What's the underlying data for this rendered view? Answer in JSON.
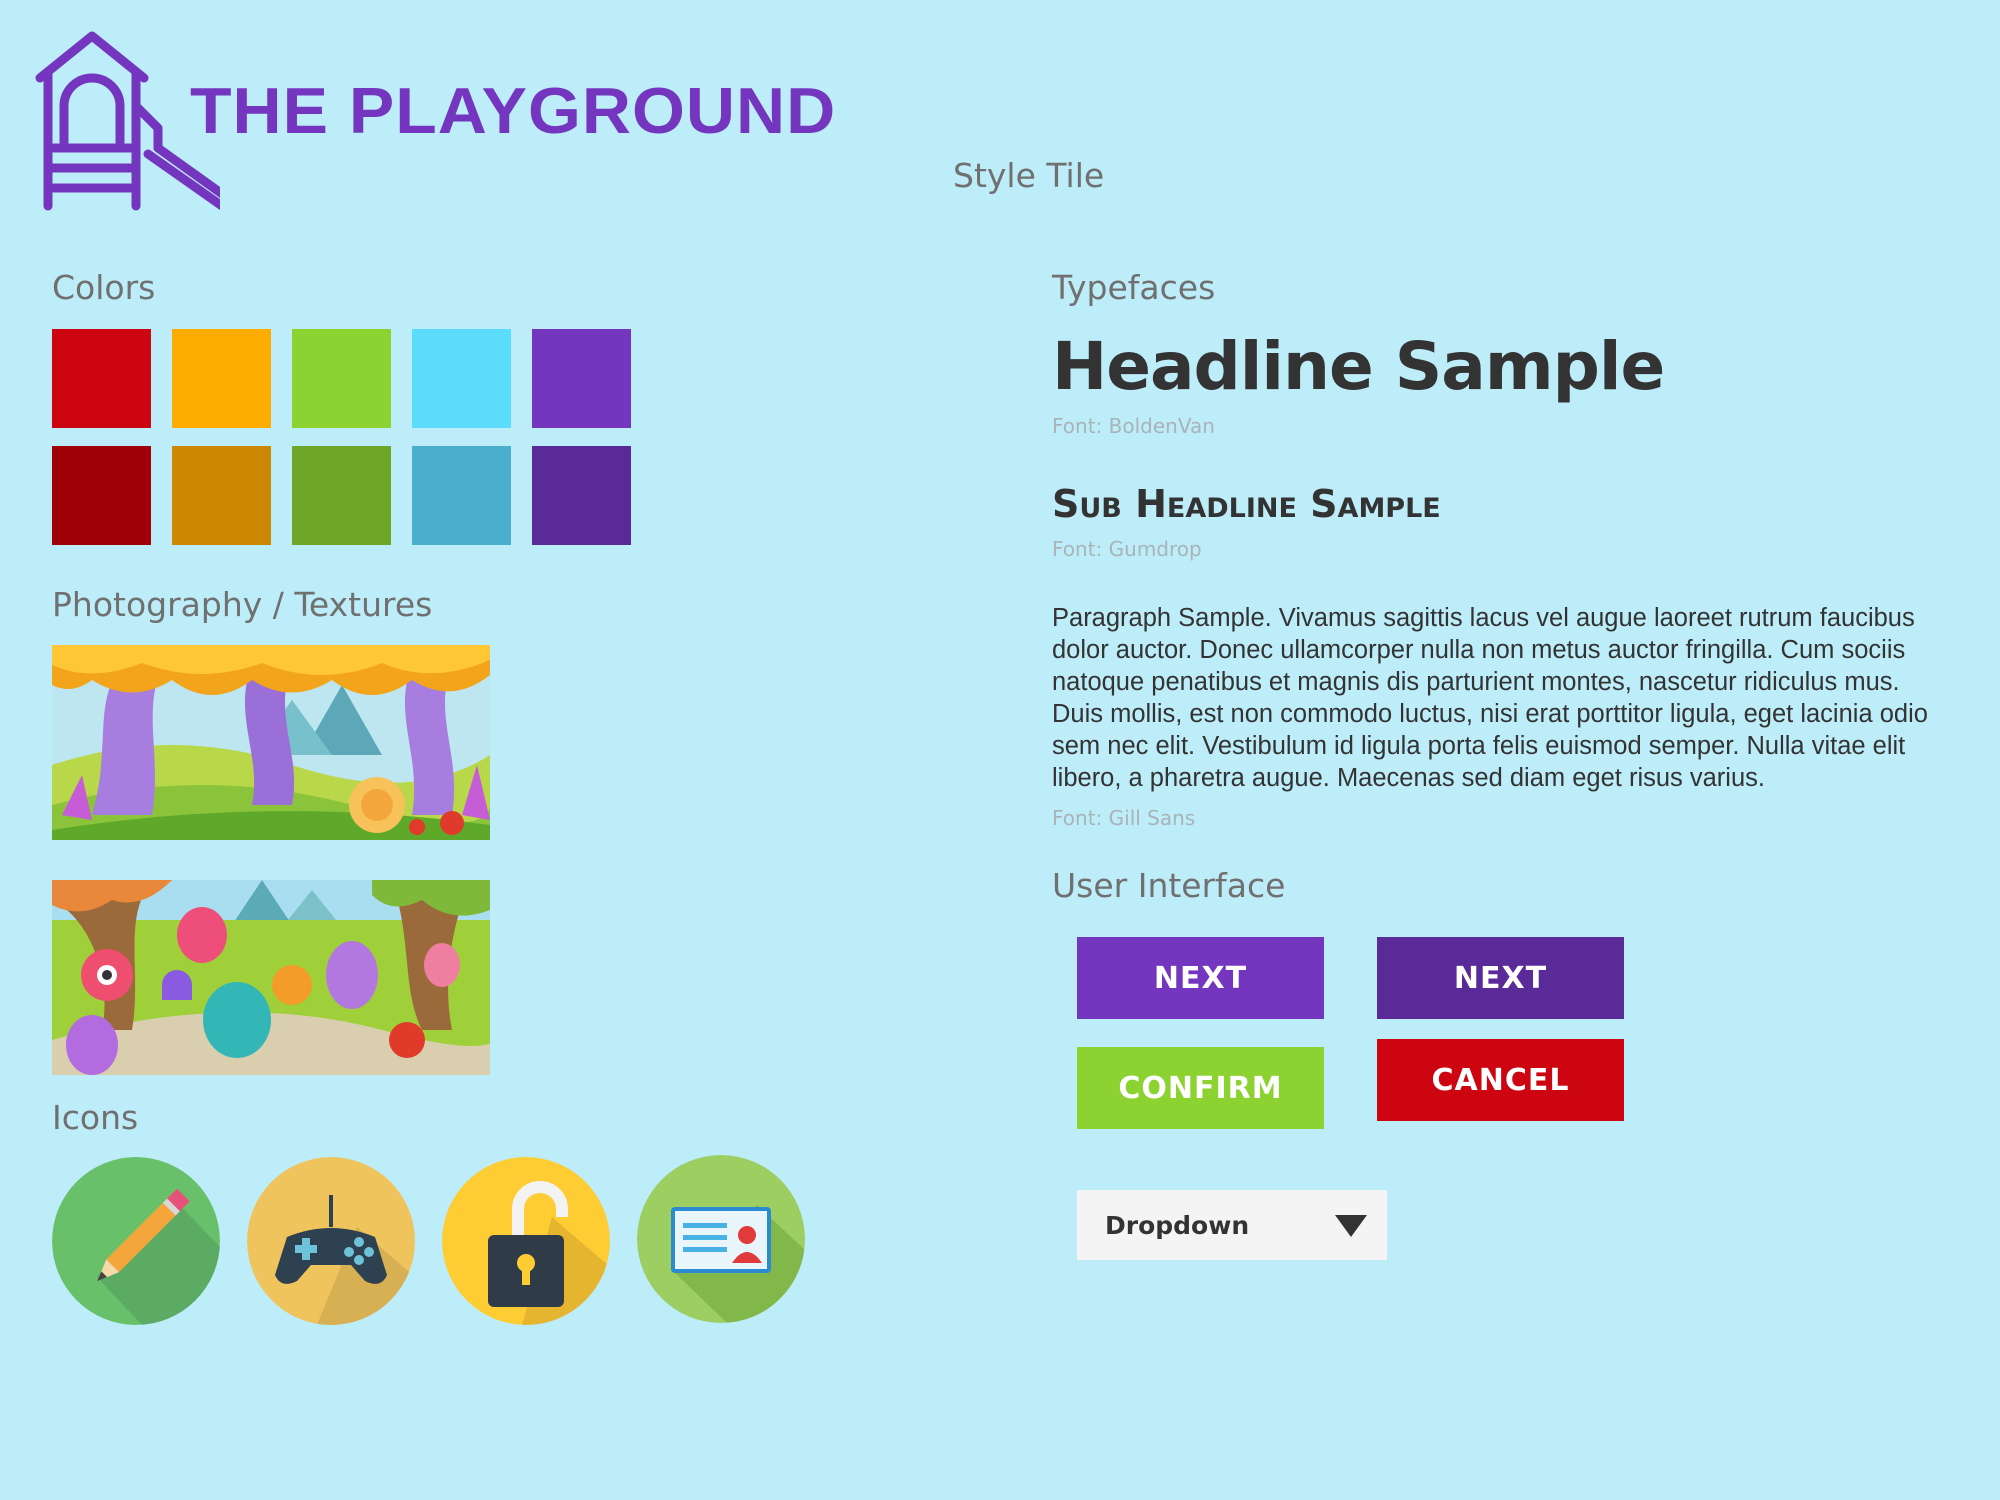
{
  "header": {
    "brand_title": "THE PLAYGROUND",
    "tile_title": "Style Tile"
  },
  "colors": {
    "label": "Colors",
    "row1": [
      "#cc0511",
      "#ffac00",
      "#8cd332",
      "#5cdcfb",
      "#7436bf"
    ],
    "row2": [
      "#a00008",
      "#cc8800",
      "#6ea628",
      "#4aaecd",
      "#5a2a98"
    ]
  },
  "photography": {
    "label": "Photography / Textures"
  },
  "icons": {
    "label": "Icons",
    "items": [
      "pencil-icon",
      "gamepad-icon",
      "unlocked-padlock-icon",
      "id-card-icon"
    ]
  },
  "typefaces": {
    "label": "Typefaces",
    "headline": "Headline Sample",
    "headline_font": "Font: BoldenVan",
    "subheadline": "Sub Headline Sample",
    "subheadline_font": "Font: Gumdrop",
    "paragraph": "Paragraph Sample. Vivamus sagittis lacus vel augue laoreet rutrum faucibus dolor auctor. Donec ullamcorper nulla non metus auctor fringilla. Cum sociis natoque penatibus et magnis dis parturient montes, nascetur ridiculus mus. Duis mollis, est non commodo luctus, nisi erat porttitor ligula, eget lacinia odio sem nec elit. Vestibulum id ligula porta felis euismod semper. Nulla vitae elit libero, a pharetra augue. Maecenas sed diam eget risus varius.",
    "paragraph_font": "Font: Gill Sans"
  },
  "ui": {
    "label": "User Interface",
    "next_label": "NEXT",
    "next_label_alt": "NEXT",
    "confirm_label": "CONFIRM",
    "cancel_label": "CANCEL",
    "dropdown_label": "Dropdown"
  }
}
